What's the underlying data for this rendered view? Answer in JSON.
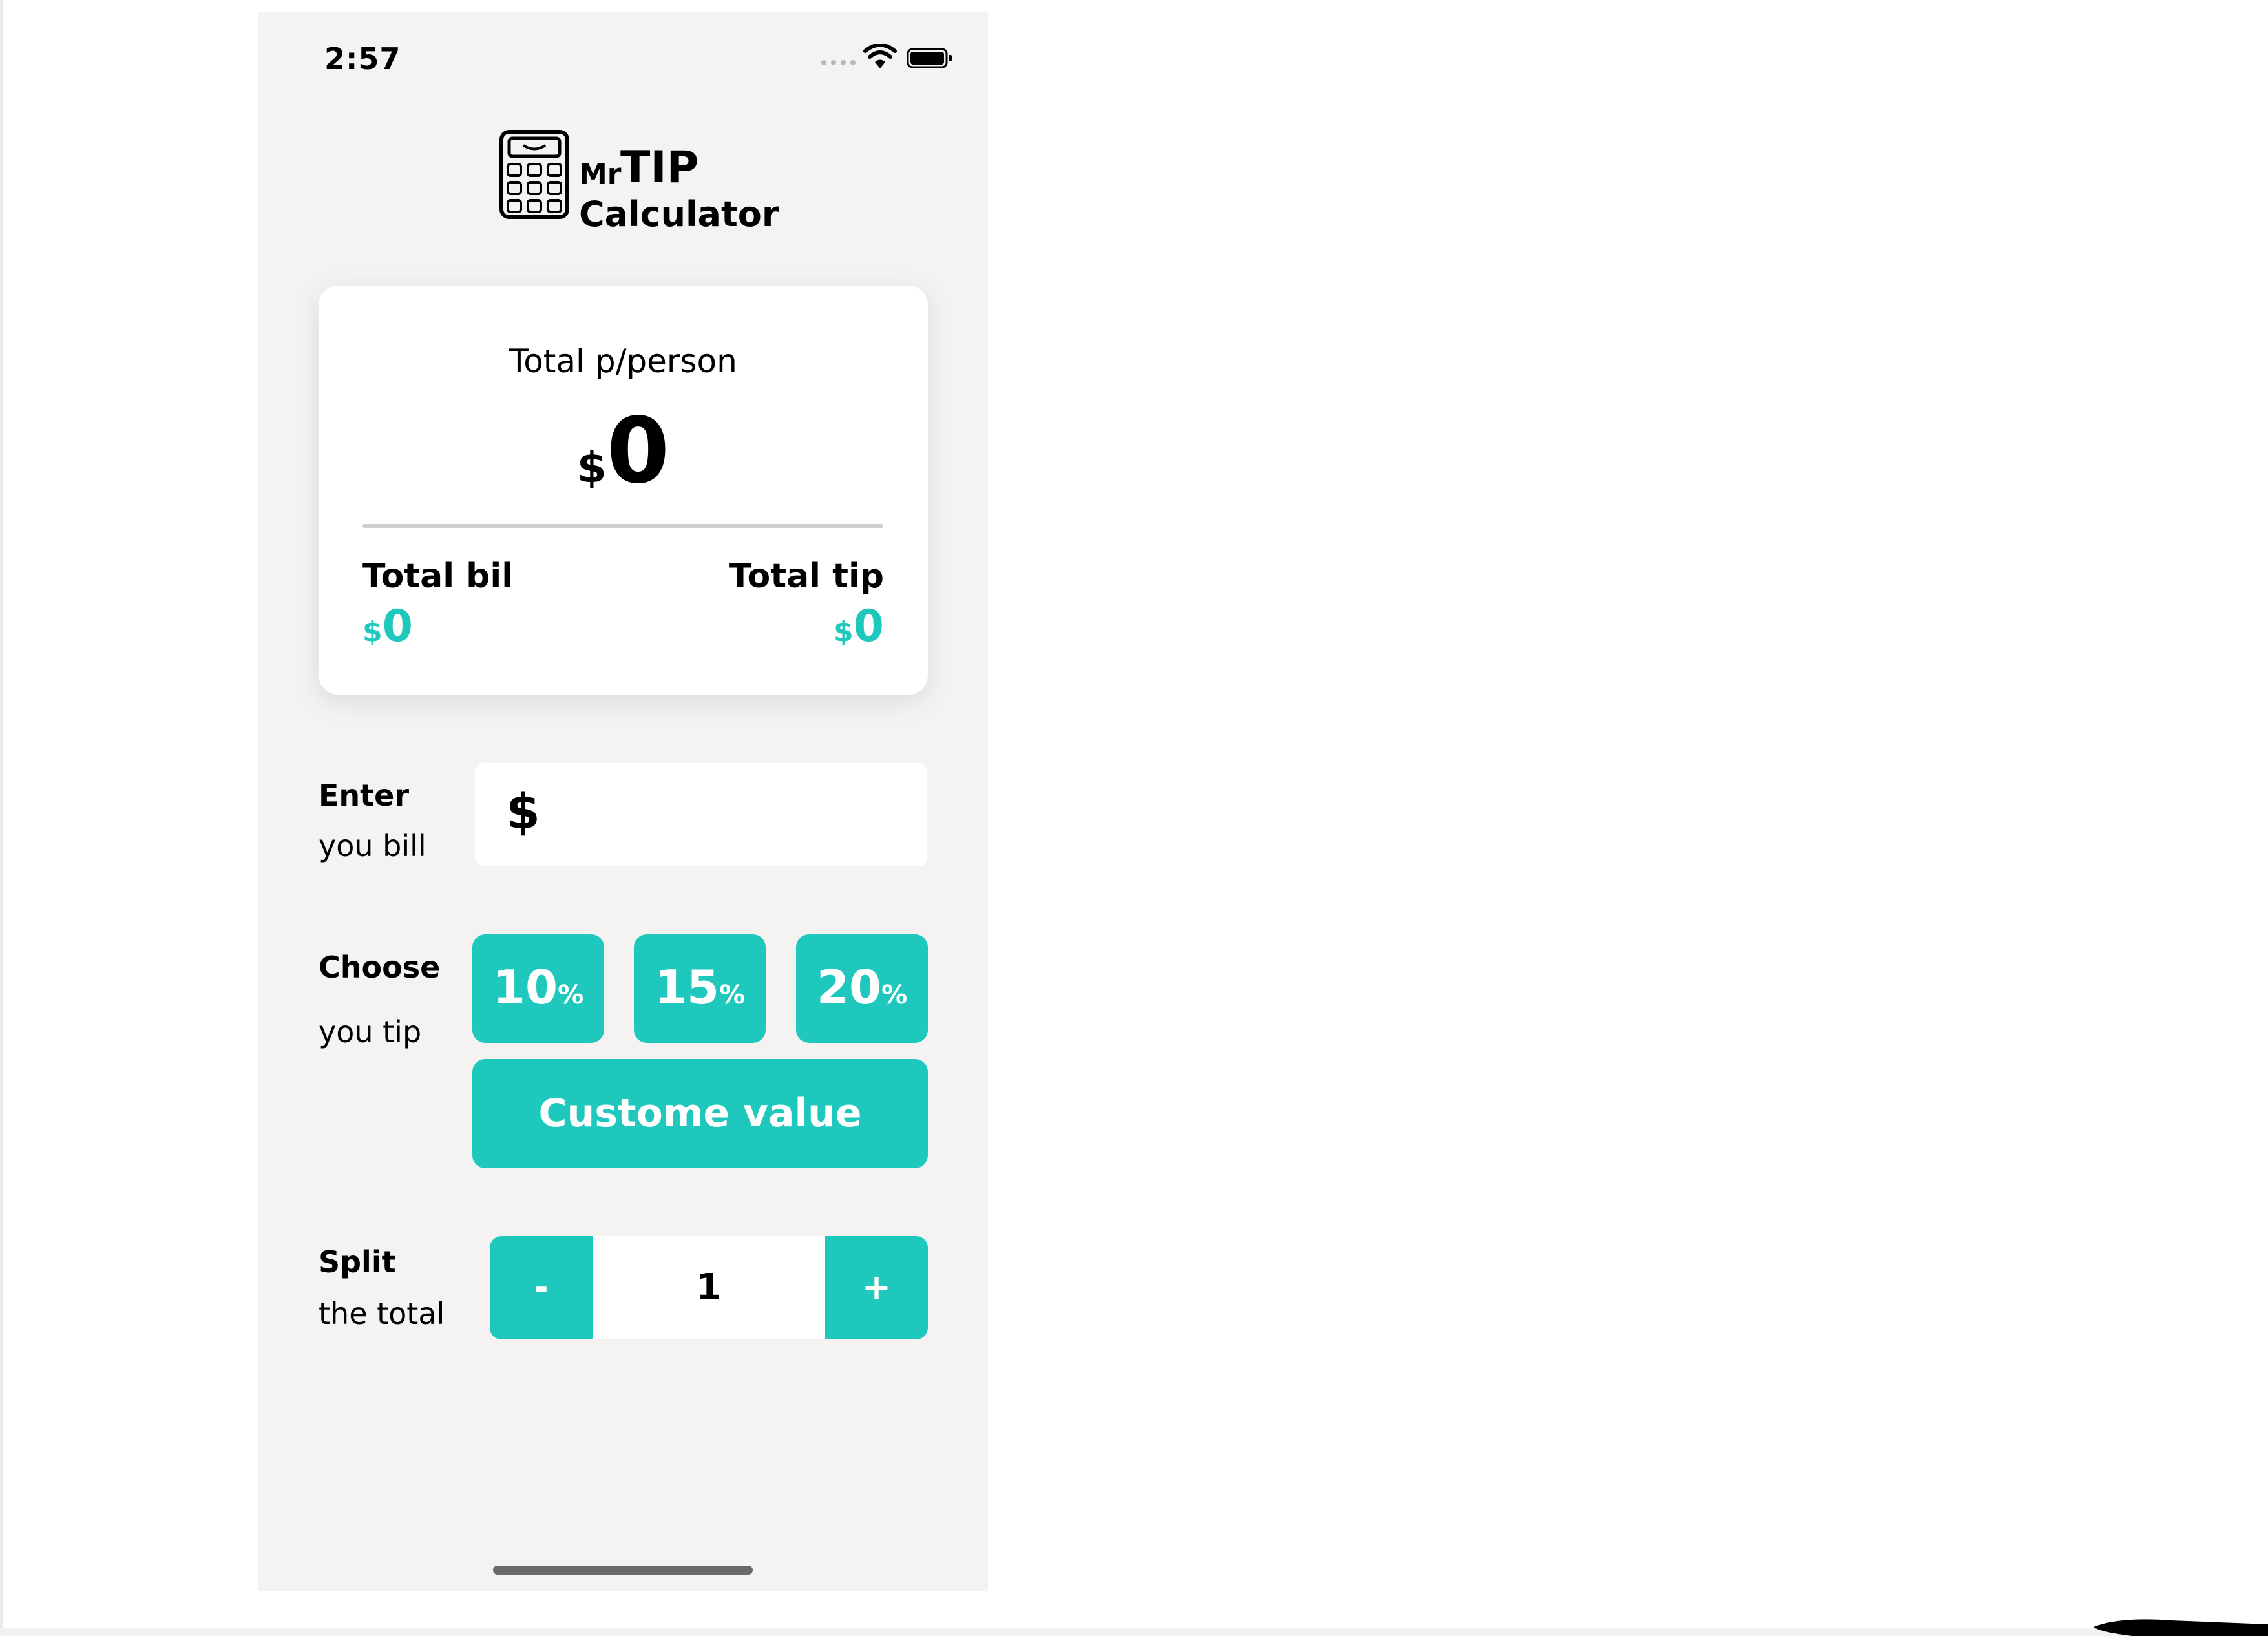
{
  "status_bar": {
    "time": "2:57",
    "icons": [
      "cellular-signal-icon",
      "wifi-icon",
      "battery-icon"
    ]
  },
  "logo": {
    "icon": "calculator-icon",
    "mr": "Mr",
    "tip": "TIP",
    "calculator": "Calculator"
  },
  "result_card": {
    "title": "Total p/person",
    "per_person_currency": "$",
    "per_person_value": "0",
    "total_bill_label": "Total bil",
    "total_bill_currency": "$",
    "total_bill_value": "0",
    "total_tip_label": "Total tip",
    "total_tip_currency": "$",
    "total_tip_value": "0"
  },
  "bill": {
    "label_bold": "Enter",
    "label_light": "you bill",
    "currency": "$",
    "value": ""
  },
  "tip": {
    "label_bold": "Choose",
    "label_light": "you tip",
    "options": [
      {
        "value": "10",
        "unit": "%"
      },
      {
        "value": "15",
        "unit": "%"
      },
      {
        "value": "20",
        "unit": "%"
      }
    ],
    "custom_label": "Custome value"
  },
  "split": {
    "label_bold": "Split",
    "label_light": "the total",
    "minus": "-",
    "value": "1",
    "plus": "+"
  },
  "colors": {
    "accent": "#1fc8bd",
    "phone_background": "#f4f3f1",
    "card_background": "#ffffff",
    "text": "#000000"
  }
}
